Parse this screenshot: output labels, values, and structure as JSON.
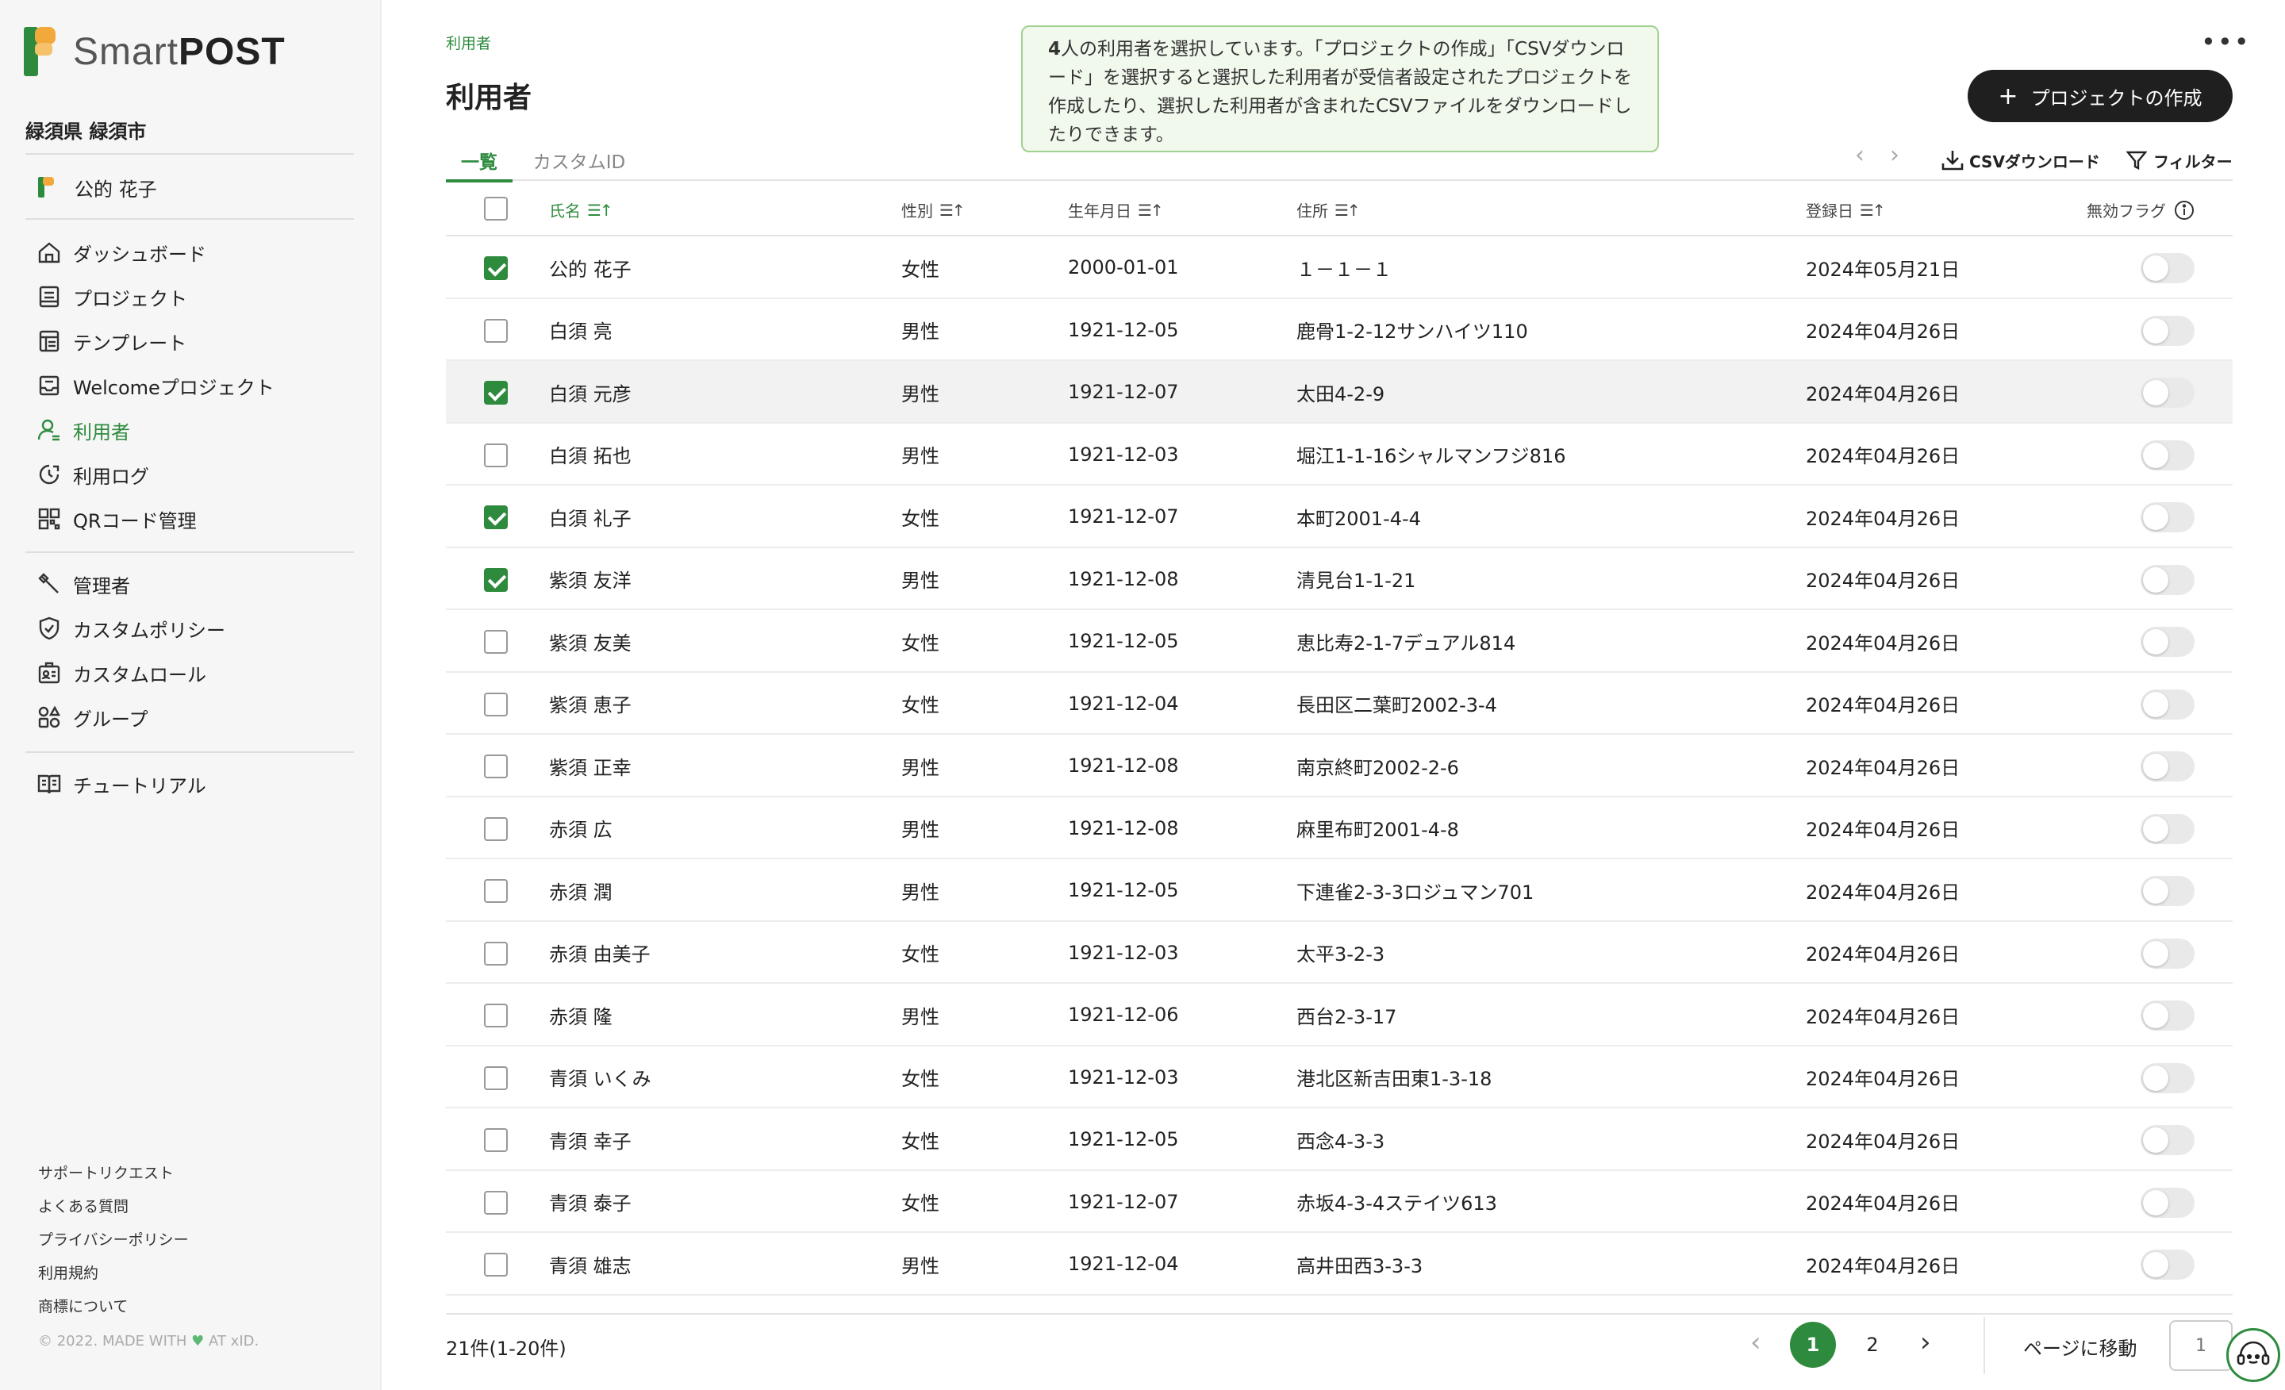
{
  "brand": {
    "name_light": "Smart",
    "name_bold": "POST"
  },
  "sidebar": {
    "org": "緑須県 緑須市",
    "user": "公的 花子",
    "nav": [
      {
        "label": "ダッシュボード",
        "icon": "home-icon"
      },
      {
        "label": "プロジェクト",
        "icon": "project-icon"
      },
      {
        "label": "テンプレート",
        "icon": "template-icon"
      },
      {
        "label": "Welcomeプロジェクト",
        "icon": "welcome-icon"
      },
      {
        "label": "利用者",
        "icon": "user-icon",
        "active": true
      },
      {
        "label": "利用ログ",
        "icon": "log-icon"
      },
      {
        "label": "QRコード管理",
        "icon": "qr-icon"
      }
    ],
    "admin_nav": [
      {
        "label": "管理者",
        "icon": "wrench-icon"
      },
      {
        "label": "カスタムポリシー",
        "icon": "shield-icon"
      },
      {
        "label": "カスタムロール",
        "icon": "role-icon"
      },
      {
        "label": "グループ",
        "icon": "group-icon"
      }
    ],
    "tutorial": {
      "label": "チュートリアル",
      "icon": "book-icon"
    },
    "footer_links": [
      "サポートリクエスト",
      "よくある質問",
      "プライバシーポリシー",
      "利用規約",
      "商標について"
    ],
    "copyright_prefix": "© 2022. MADE WITH",
    "copyright_suffix": "AT xID."
  },
  "header": {
    "breadcrumb": "利用者",
    "title": "利用者",
    "notice_count": "4",
    "notice": "人の利用者を選択しています。「プロジェクトの作成」「CSVダウンロード」を選択すると選択した利用者が受信者設定されたプロジェクトを作成したり、選択した利用者が含まれたCSVファイルをダウンロードしたりできます。",
    "more": "•••",
    "create_button": "プロジェクトの作成",
    "accent_color": "#2e8b3e"
  },
  "tabs": [
    "一覧",
    "カスタムID"
  ],
  "toolbar": {
    "csv": "CSVダウンロード",
    "filter": "フィルター"
  },
  "table": {
    "columns": {
      "name": "氏名",
      "gender": "性別",
      "birth": "生年月日",
      "address": "住所",
      "registered": "登録日",
      "disabled": "無効フラグ"
    },
    "rows": [
      {
        "checked": true,
        "name": "公的 花子",
        "gender": "女性",
        "birth": "2000-01-01",
        "address": "１－１－１",
        "registered": "2024年05月21日"
      },
      {
        "checked": false,
        "name": "白須 亮",
        "gender": "男性",
        "birth": "1921-12-05",
        "address": "鹿骨1-2-12サンハイツ110",
        "registered": "2024年04月26日"
      },
      {
        "checked": true,
        "name": "白須 元彦",
        "gender": "男性",
        "birth": "1921-12-07",
        "address": "太田4-2-9",
        "registered": "2024年04月26日"
      },
      {
        "checked": false,
        "name": "白須 拓也",
        "gender": "男性",
        "birth": "1921-12-03",
        "address": "堀江1-1-16シャルマンフジ816",
        "registered": "2024年04月26日"
      },
      {
        "checked": true,
        "name": "白須 礼子",
        "gender": "女性",
        "birth": "1921-12-07",
        "address": "本町2001-4-4",
        "registered": "2024年04月26日"
      },
      {
        "checked": true,
        "name": "紫須 友洋",
        "gender": "男性",
        "birth": "1921-12-08",
        "address": "清見台1-1-21",
        "registered": "2024年04月26日"
      },
      {
        "checked": false,
        "name": "紫須 友美",
        "gender": "女性",
        "birth": "1921-12-05",
        "address": "恵比寿2-1-7デュアル814",
        "registered": "2024年04月26日"
      },
      {
        "checked": false,
        "name": "紫須 恵子",
        "gender": "女性",
        "birth": "1921-12-04",
        "address": "長田区二葉町2002-3-4",
        "registered": "2024年04月26日"
      },
      {
        "checked": false,
        "name": "紫須 正幸",
        "gender": "男性",
        "birth": "1921-12-08",
        "address": "南京終町2002-2-6",
        "registered": "2024年04月26日"
      },
      {
        "checked": false,
        "name": "赤須 広",
        "gender": "男性",
        "birth": "1921-12-08",
        "address": "麻里布町2001-4-8",
        "registered": "2024年04月26日"
      },
      {
        "checked": false,
        "name": "赤須 潤",
        "gender": "男性",
        "birth": "1921-12-05",
        "address": "下連雀2-3-3ロジュマン701",
        "registered": "2024年04月26日"
      },
      {
        "checked": false,
        "name": "赤須 由美子",
        "gender": "女性",
        "birth": "1921-12-03",
        "address": "太平3-2-3",
        "registered": "2024年04月26日"
      },
      {
        "checked": false,
        "name": "赤須 隆",
        "gender": "男性",
        "birth": "1921-12-06",
        "address": "西台2-3-17",
        "registered": "2024年04月26日"
      },
      {
        "checked": false,
        "name": "青須 いくみ",
        "gender": "女性",
        "birth": "1921-12-03",
        "address": "港北区新吉田東1-3-18",
        "registered": "2024年04月26日"
      },
      {
        "checked": false,
        "name": "青須 幸子",
        "gender": "女性",
        "birth": "1921-12-05",
        "address": "西念4-3-3",
        "registered": "2024年04月26日"
      },
      {
        "checked": false,
        "name": "青須 泰子",
        "gender": "女性",
        "birth": "1921-12-07",
        "address": "赤坂4-3-4ステイツ613",
        "registered": "2024年04月26日"
      },
      {
        "checked": false,
        "name": "青須 雄志",
        "gender": "男性",
        "birth": "1921-12-04",
        "address": "高井田西3-3-3",
        "registered": "2024年04月26日"
      }
    ]
  },
  "pagination": {
    "summary": "21件(1-20件)",
    "pages": [
      "1",
      "2"
    ],
    "current": "1",
    "goto_label": "ページに移動",
    "goto_placeholder": "1"
  }
}
